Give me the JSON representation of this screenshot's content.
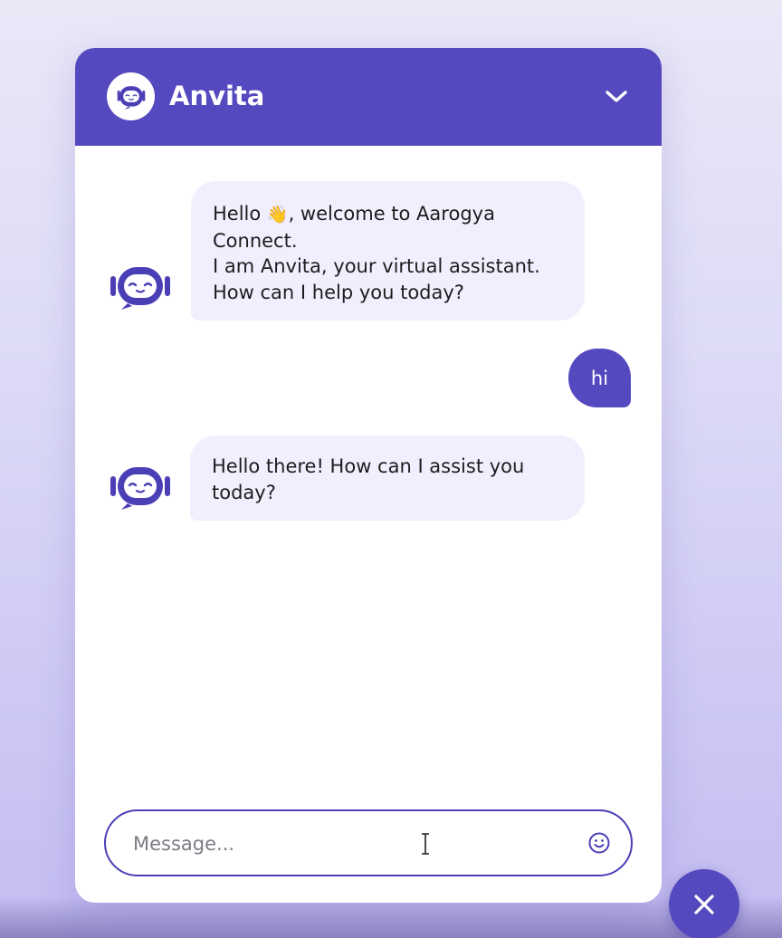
{
  "header": {
    "title": "Anvita",
    "collapse_icon": "chevron-down-icon",
    "avatar_icon": "robot-icon"
  },
  "messages": [
    {
      "sender": "bot",
      "lines": [
        "Hello ",
        ", welcome to Aarogya",
        "Connect.",
        "I am Anvita, your virtual assistant.",
        "How can I help you today?"
      ],
      "emoji": "👋"
    },
    {
      "sender": "user",
      "text": "hi"
    },
    {
      "sender": "bot",
      "lines": [
        "Hello there! How can I assist you",
        "today?"
      ]
    }
  ],
  "composer": {
    "placeholder": "Message...",
    "value": "",
    "emoji_icon": "smiley-icon"
  },
  "fab": {
    "icon": "close-icon"
  },
  "colors": {
    "brand": "#5549bf",
    "bot_bubble": "#f1effd",
    "user_bubble": "#5549bf",
    "background": "#dcdaf6"
  }
}
